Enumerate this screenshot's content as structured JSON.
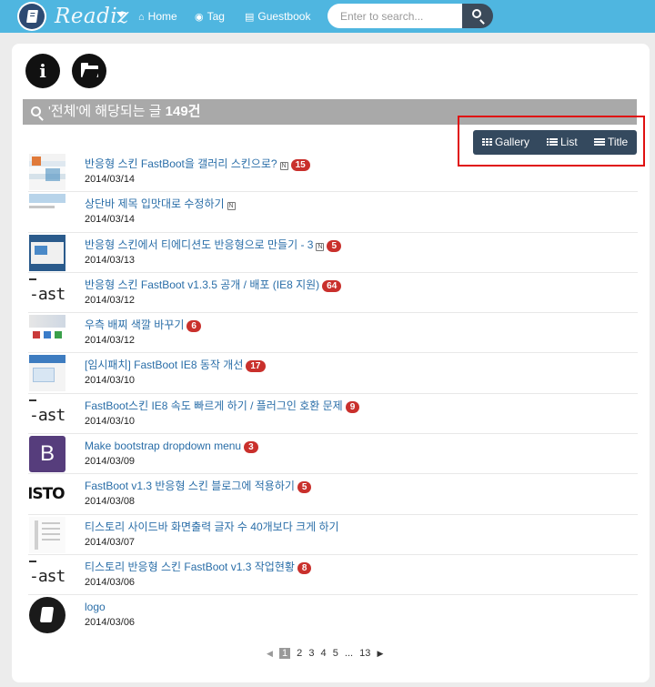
{
  "nav": {
    "brand": "Readiz",
    "links": [
      {
        "label": "Home",
        "icon": "home-icon"
      },
      {
        "label": "Tag",
        "icon": "tag-icon"
      },
      {
        "label": "Guestbook",
        "icon": "book-icon"
      }
    ],
    "search_placeholder": "Enter to search..."
  },
  "header": {
    "prefix": "'전체'에 해당되는 글",
    "count": "149건"
  },
  "view_toggle": {
    "gallery": "Gallery",
    "list": "List",
    "title": "Title"
  },
  "posts": [
    {
      "title": "반응형 스킨 FastBoot을 갤러리 스킨으로?",
      "date": "2014/03/14",
      "new": "N",
      "comments": "15"
    },
    {
      "title": "상단바 제목 입맛대로 수정하기",
      "date": "2014/03/14",
      "new": "N",
      "comments": ""
    },
    {
      "title": "반응형 스킨에서 티에디션도 반응형으로 만들기 - 3",
      "date": "2014/03/13",
      "new": "N",
      "comments": "5"
    },
    {
      "title": "반응형 스킨 FastBoot v1.3.5 공개 / 배포 (IE8 지원)",
      "date": "2014/03/12",
      "new": "",
      "comments": "64"
    },
    {
      "title": "우측 배찌 색깔 바꾸기",
      "date": "2014/03/12",
      "new": "",
      "comments": "6"
    },
    {
      "title": "[임시패치] FastBoot IE8 동작 개선",
      "date": "2014/03/10",
      "new": "",
      "comments": "17"
    },
    {
      "title": "FastBoot스킨 IE8 속도 빠르게 하기 / 플러그인 호환 문제",
      "date": "2014/03/10",
      "new": "",
      "comments": "9"
    },
    {
      "title": "Make bootstrap dropdown menu",
      "date": "2014/03/09",
      "new": "",
      "comments": "3"
    },
    {
      "title": "FastBoot v1.3 반응형 스킨 블로그에 적용하기",
      "date": "2014/03/08",
      "new": "",
      "comments": "5"
    },
    {
      "title": "티스토리 사이드바 화면출력 글자 수 40개보다 크게 하기",
      "date": "2014/03/07",
      "new": "",
      "comments": ""
    },
    {
      "title": "티스토리 반응형 스킨 FastBoot v1.3 작업현황",
      "date": "2014/03/06",
      "new": "",
      "comments": "8"
    },
    {
      "title": "logo",
      "date": "2014/03/06",
      "new": "",
      "comments": ""
    }
  ],
  "thumbs": {
    "boot_letter": "B",
    "isto_text": "ISTO",
    "stick_text": "-ast"
  },
  "pagination": {
    "prev": "◀",
    "pages": [
      "1",
      "2",
      "3",
      "4",
      "5"
    ],
    "ellipsis": "...",
    "last": "13",
    "next": "▶"
  },
  "colors": {
    "nav_bg": "#4fb6e0",
    "view_bar": "#34495e",
    "badge": "#c9302c",
    "link": "#2a6ea8",
    "highlight_box": "#e01010"
  }
}
